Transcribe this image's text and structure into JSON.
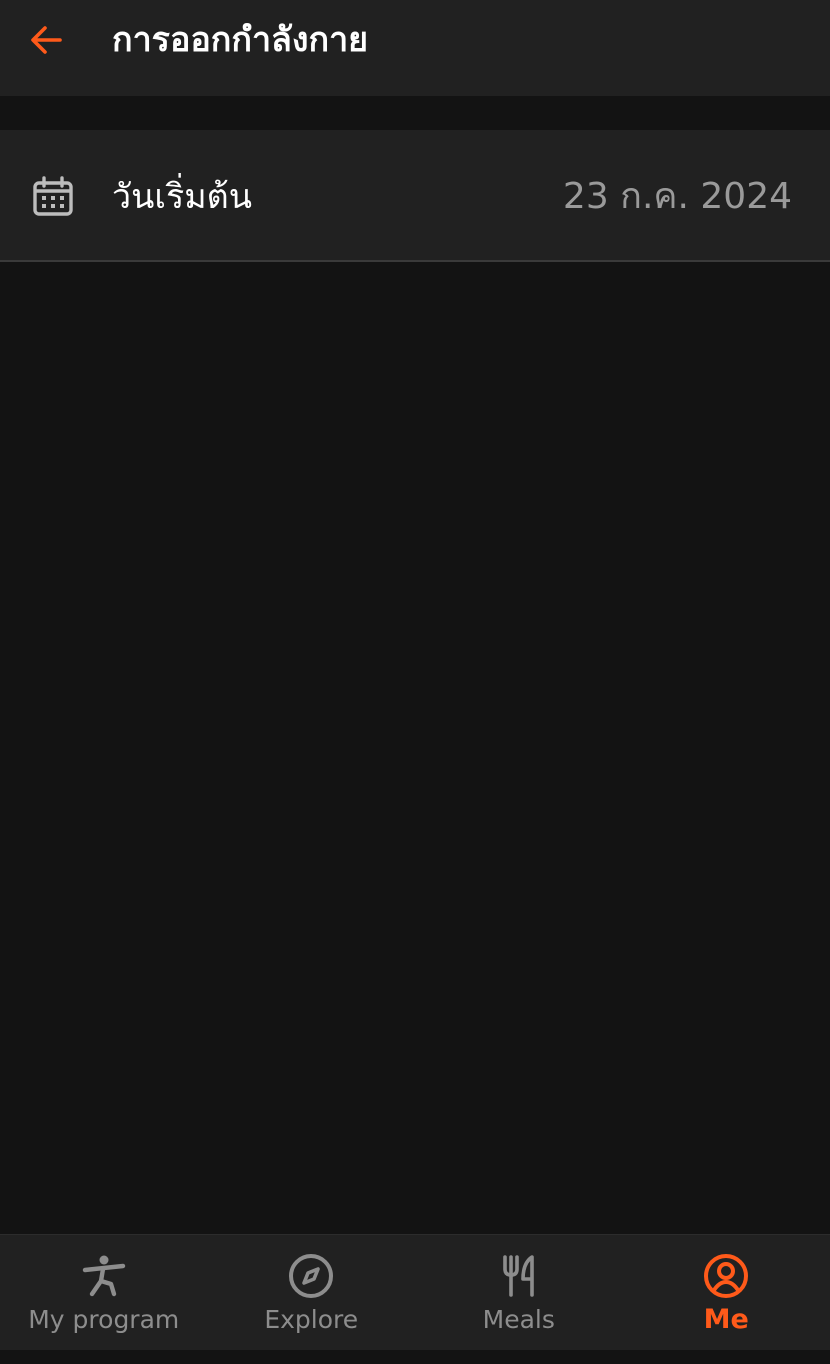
{
  "header": {
    "title": "การออกกำลังกาย",
    "back_icon": "arrow-left-icon",
    "accent_color": "#ff5a1a"
  },
  "start_date_row": {
    "icon": "calendar-icon",
    "label": "วันเริ่มต้น",
    "value": "23 ก.ค. 2024"
  },
  "bottom_nav": {
    "items": [
      {
        "label": "My program",
        "icon": "exercise-person-icon",
        "active": false
      },
      {
        "label": "Explore",
        "icon": "compass-icon",
        "active": false
      },
      {
        "label": "Meals",
        "icon": "fork-knife-icon",
        "active": false
      },
      {
        "label": "Me",
        "icon": "profile-icon",
        "active": true
      }
    ],
    "active_color": "#ff5a1a",
    "inactive_color": "#8d8d8d"
  }
}
